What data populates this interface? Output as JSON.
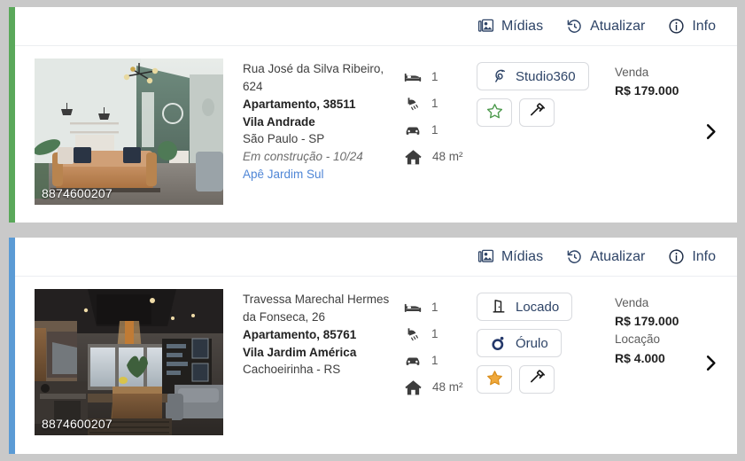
{
  "colors": {
    "accent_green": "#5aa85a",
    "accent_blue": "#5b9bd5",
    "header_text": "#2e4467",
    "link": "#4f86d6",
    "star_outline_green": "#4e9a4e",
    "star_filled_orange": "#e8a33d",
    "page_background": "#c9c9c9"
  },
  "cards": [
    {
      "accent_color": "#5aa85a",
      "header": {
        "media_label": "Mídias",
        "media_icon": "images-icon",
        "refresh_label": "Atualizar",
        "refresh_icon": "history-rotate-icon",
        "info_label": "Info",
        "info_icon": "info-circle-icon"
      },
      "thumbnail": {
        "code": "8874600207",
        "alt": "living room with tan leather sofa and green accent wall"
      },
      "address": "Rua José da Silva Ribeiro, 624",
      "property_type": "Apartamento, 38511",
      "neighborhood": "Vila Andrade",
      "city": "São Paulo - SP",
      "status": "Em construção - 10/24",
      "development": "Apê Jardim Sul",
      "features": [
        {
          "icon": "bed-icon",
          "value": "1"
        },
        {
          "icon": "shower-icon",
          "value": "1"
        },
        {
          "icon": "car-icon",
          "value": "1"
        },
        {
          "icon": "house-icon",
          "value": "48 m²"
        }
      ],
      "buttons": [
        {
          "label": "Studio360",
          "icon": "studio360-chameleon-icon"
        }
      ],
      "icon_buttons": [
        {
          "icon": "star-icon",
          "state": "outline-green"
        },
        {
          "icon": "gavel-icon",
          "state": "default"
        }
      ],
      "prices": [
        {
          "label": "Venda",
          "value": "R$ 179.000"
        }
      ],
      "chevron_icon": "chevron-right-icon"
    },
    {
      "accent_color": "#5b9bd5",
      "header": {
        "media_label": "Mídias",
        "media_icon": "images-icon",
        "refresh_label": "Atualizar",
        "refresh_icon": "history-rotate-icon",
        "info_label": "Info",
        "info_icon": "info-circle-icon"
      },
      "thumbnail": {
        "code": "8874600207",
        "alt": "dark modern kitchen and living area with island"
      },
      "address": "Travessa Marechal Hermes da Fonseca, 26",
      "property_type": "Apartamento, 85761",
      "neighborhood": "Vila Jardim América",
      "city": "Cachoeirinha - RS",
      "status": "",
      "development": "",
      "features": [
        {
          "icon": "bed-icon",
          "value": "1"
        },
        {
          "icon": "shower-icon",
          "value": "1"
        },
        {
          "icon": "car-icon",
          "value": "1"
        },
        {
          "icon": "house-icon",
          "value": "48 m²"
        }
      ],
      "buttons": [
        {
          "label": "Locado",
          "icon": "door-icon"
        },
        {
          "label": "Órulo",
          "icon": "orulo-logo-icon"
        }
      ],
      "icon_buttons": [
        {
          "icon": "star-icon",
          "state": "filled-orange"
        },
        {
          "icon": "gavel-icon",
          "state": "default"
        }
      ],
      "prices": [
        {
          "label": "Venda",
          "value": "R$ 179.000"
        },
        {
          "label": "Locação",
          "value": "R$ 4.000"
        }
      ],
      "chevron_icon": "chevron-right-icon"
    }
  ]
}
